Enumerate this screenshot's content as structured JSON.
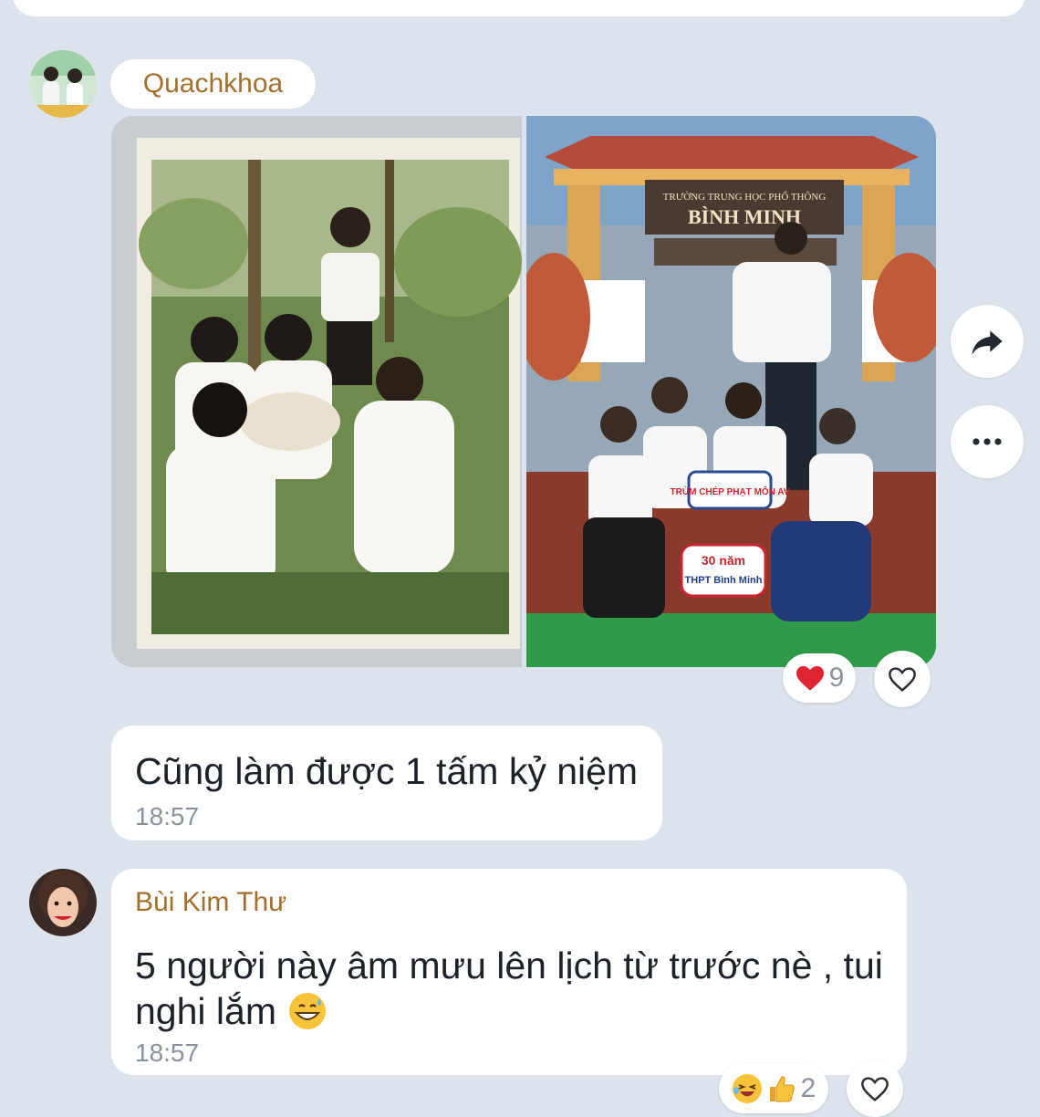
{
  "message1": {
    "sender": "Quachkhoa",
    "avatar_icon": "couple-avatar-photo",
    "photos": [
      {
        "name": "old-group-photo",
        "description_icon": "photo-icon"
      },
      {
        "name": "reunion-group-photo",
        "description_icon": "photo-icon"
      }
    ],
    "school_sign": {
      "title_small": "TRƯỜNG TRUNG HỌC PHỔ THÔNG",
      "title_big": "BÌNH MINH",
      "sign_badge": "TRÙM CHÉP PHẠT MÔN AV",
      "banner_top": "30 năm",
      "banner_bottom": "THPT Bình Minh"
    },
    "reactions": {
      "heart_icon": "heart-filled-icon",
      "count": "9"
    }
  },
  "message2": {
    "text": "Cũng làm được 1 tấm kỷ niệm",
    "time": "18:57"
  },
  "message3": {
    "sender": "Bùi Kim Thư",
    "avatar_icon": "woman-avatar-photo",
    "text_line1": "5 người này âm mưu lên lịch từ trước nè , tui",
    "text_line2": "nghi lắm",
    "emoji": "grinning-sweat-emoji",
    "time": "18:57",
    "reactions": {
      "icons": [
        "laughing-emoji",
        "thumbs-up-icon"
      ],
      "count": "2"
    }
  },
  "actions": {
    "share_icon": "share-arrow-icon",
    "more_icon": "more-horizontal-icon",
    "like_icon": "heart-outline-icon"
  },
  "colors": {
    "background": "#dde3ec",
    "bubble": "#ffffff",
    "sender_name": "#a0712e",
    "heart": "#e02433"
  }
}
